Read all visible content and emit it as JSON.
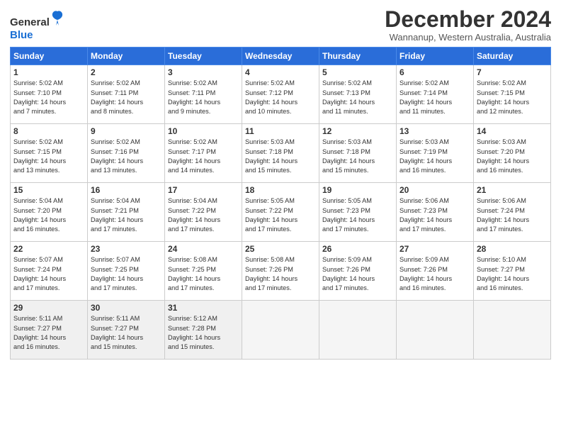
{
  "header": {
    "logo_general": "General",
    "logo_blue": "Blue",
    "month_title": "December 2024",
    "location": "Wannanup, Western Australia, Australia"
  },
  "weekdays": [
    "Sunday",
    "Monday",
    "Tuesday",
    "Wednesday",
    "Thursday",
    "Friday",
    "Saturday"
  ],
  "weeks": [
    [
      {
        "day": "1",
        "info": "Sunrise: 5:02 AM\nSunset: 7:10 PM\nDaylight: 14 hours\nand 7 minutes."
      },
      {
        "day": "2",
        "info": "Sunrise: 5:02 AM\nSunset: 7:11 PM\nDaylight: 14 hours\nand 8 minutes."
      },
      {
        "day": "3",
        "info": "Sunrise: 5:02 AM\nSunset: 7:11 PM\nDaylight: 14 hours\nand 9 minutes."
      },
      {
        "day": "4",
        "info": "Sunrise: 5:02 AM\nSunset: 7:12 PM\nDaylight: 14 hours\nand 10 minutes."
      },
      {
        "day": "5",
        "info": "Sunrise: 5:02 AM\nSunset: 7:13 PM\nDaylight: 14 hours\nand 11 minutes."
      },
      {
        "day": "6",
        "info": "Sunrise: 5:02 AM\nSunset: 7:14 PM\nDaylight: 14 hours\nand 11 minutes."
      },
      {
        "day": "7",
        "info": "Sunrise: 5:02 AM\nSunset: 7:15 PM\nDaylight: 14 hours\nand 12 minutes."
      }
    ],
    [
      {
        "day": "8",
        "info": "Sunrise: 5:02 AM\nSunset: 7:15 PM\nDaylight: 14 hours\nand 13 minutes."
      },
      {
        "day": "9",
        "info": "Sunrise: 5:02 AM\nSunset: 7:16 PM\nDaylight: 14 hours\nand 13 minutes."
      },
      {
        "day": "10",
        "info": "Sunrise: 5:02 AM\nSunset: 7:17 PM\nDaylight: 14 hours\nand 14 minutes."
      },
      {
        "day": "11",
        "info": "Sunrise: 5:03 AM\nSunset: 7:18 PM\nDaylight: 14 hours\nand 15 minutes."
      },
      {
        "day": "12",
        "info": "Sunrise: 5:03 AM\nSunset: 7:18 PM\nDaylight: 14 hours\nand 15 minutes."
      },
      {
        "day": "13",
        "info": "Sunrise: 5:03 AM\nSunset: 7:19 PM\nDaylight: 14 hours\nand 16 minutes."
      },
      {
        "day": "14",
        "info": "Sunrise: 5:03 AM\nSunset: 7:20 PM\nDaylight: 14 hours\nand 16 minutes."
      }
    ],
    [
      {
        "day": "15",
        "info": "Sunrise: 5:04 AM\nSunset: 7:20 PM\nDaylight: 14 hours\nand 16 minutes."
      },
      {
        "day": "16",
        "info": "Sunrise: 5:04 AM\nSunset: 7:21 PM\nDaylight: 14 hours\nand 17 minutes."
      },
      {
        "day": "17",
        "info": "Sunrise: 5:04 AM\nSunset: 7:22 PM\nDaylight: 14 hours\nand 17 minutes."
      },
      {
        "day": "18",
        "info": "Sunrise: 5:05 AM\nSunset: 7:22 PM\nDaylight: 14 hours\nand 17 minutes."
      },
      {
        "day": "19",
        "info": "Sunrise: 5:05 AM\nSunset: 7:23 PM\nDaylight: 14 hours\nand 17 minutes."
      },
      {
        "day": "20",
        "info": "Sunrise: 5:06 AM\nSunset: 7:23 PM\nDaylight: 14 hours\nand 17 minutes."
      },
      {
        "day": "21",
        "info": "Sunrise: 5:06 AM\nSunset: 7:24 PM\nDaylight: 14 hours\nand 17 minutes."
      }
    ],
    [
      {
        "day": "22",
        "info": "Sunrise: 5:07 AM\nSunset: 7:24 PM\nDaylight: 14 hours\nand 17 minutes."
      },
      {
        "day": "23",
        "info": "Sunrise: 5:07 AM\nSunset: 7:25 PM\nDaylight: 14 hours\nand 17 minutes."
      },
      {
        "day": "24",
        "info": "Sunrise: 5:08 AM\nSunset: 7:25 PM\nDaylight: 14 hours\nand 17 minutes."
      },
      {
        "day": "25",
        "info": "Sunrise: 5:08 AM\nSunset: 7:26 PM\nDaylight: 14 hours\nand 17 minutes."
      },
      {
        "day": "26",
        "info": "Sunrise: 5:09 AM\nSunset: 7:26 PM\nDaylight: 14 hours\nand 17 minutes."
      },
      {
        "day": "27",
        "info": "Sunrise: 5:09 AM\nSunset: 7:26 PM\nDaylight: 14 hours\nand 16 minutes."
      },
      {
        "day": "28",
        "info": "Sunrise: 5:10 AM\nSunset: 7:27 PM\nDaylight: 14 hours\nand 16 minutes."
      }
    ],
    [
      {
        "day": "29",
        "info": "Sunrise: 5:11 AM\nSunset: 7:27 PM\nDaylight: 14 hours\nand 16 minutes."
      },
      {
        "day": "30",
        "info": "Sunrise: 5:11 AM\nSunset: 7:27 PM\nDaylight: 14 hours\nand 15 minutes."
      },
      {
        "day": "31",
        "info": "Sunrise: 5:12 AM\nSunset: 7:28 PM\nDaylight: 14 hours\nand 15 minutes."
      },
      {
        "day": "",
        "info": ""
      },
      {
        "day": "",
        "info": ""
      },
      {
        "day": "",
        "info": ""
      },
      {
        "day": "",
        "info": ""
      }
    ]
  ]
}
